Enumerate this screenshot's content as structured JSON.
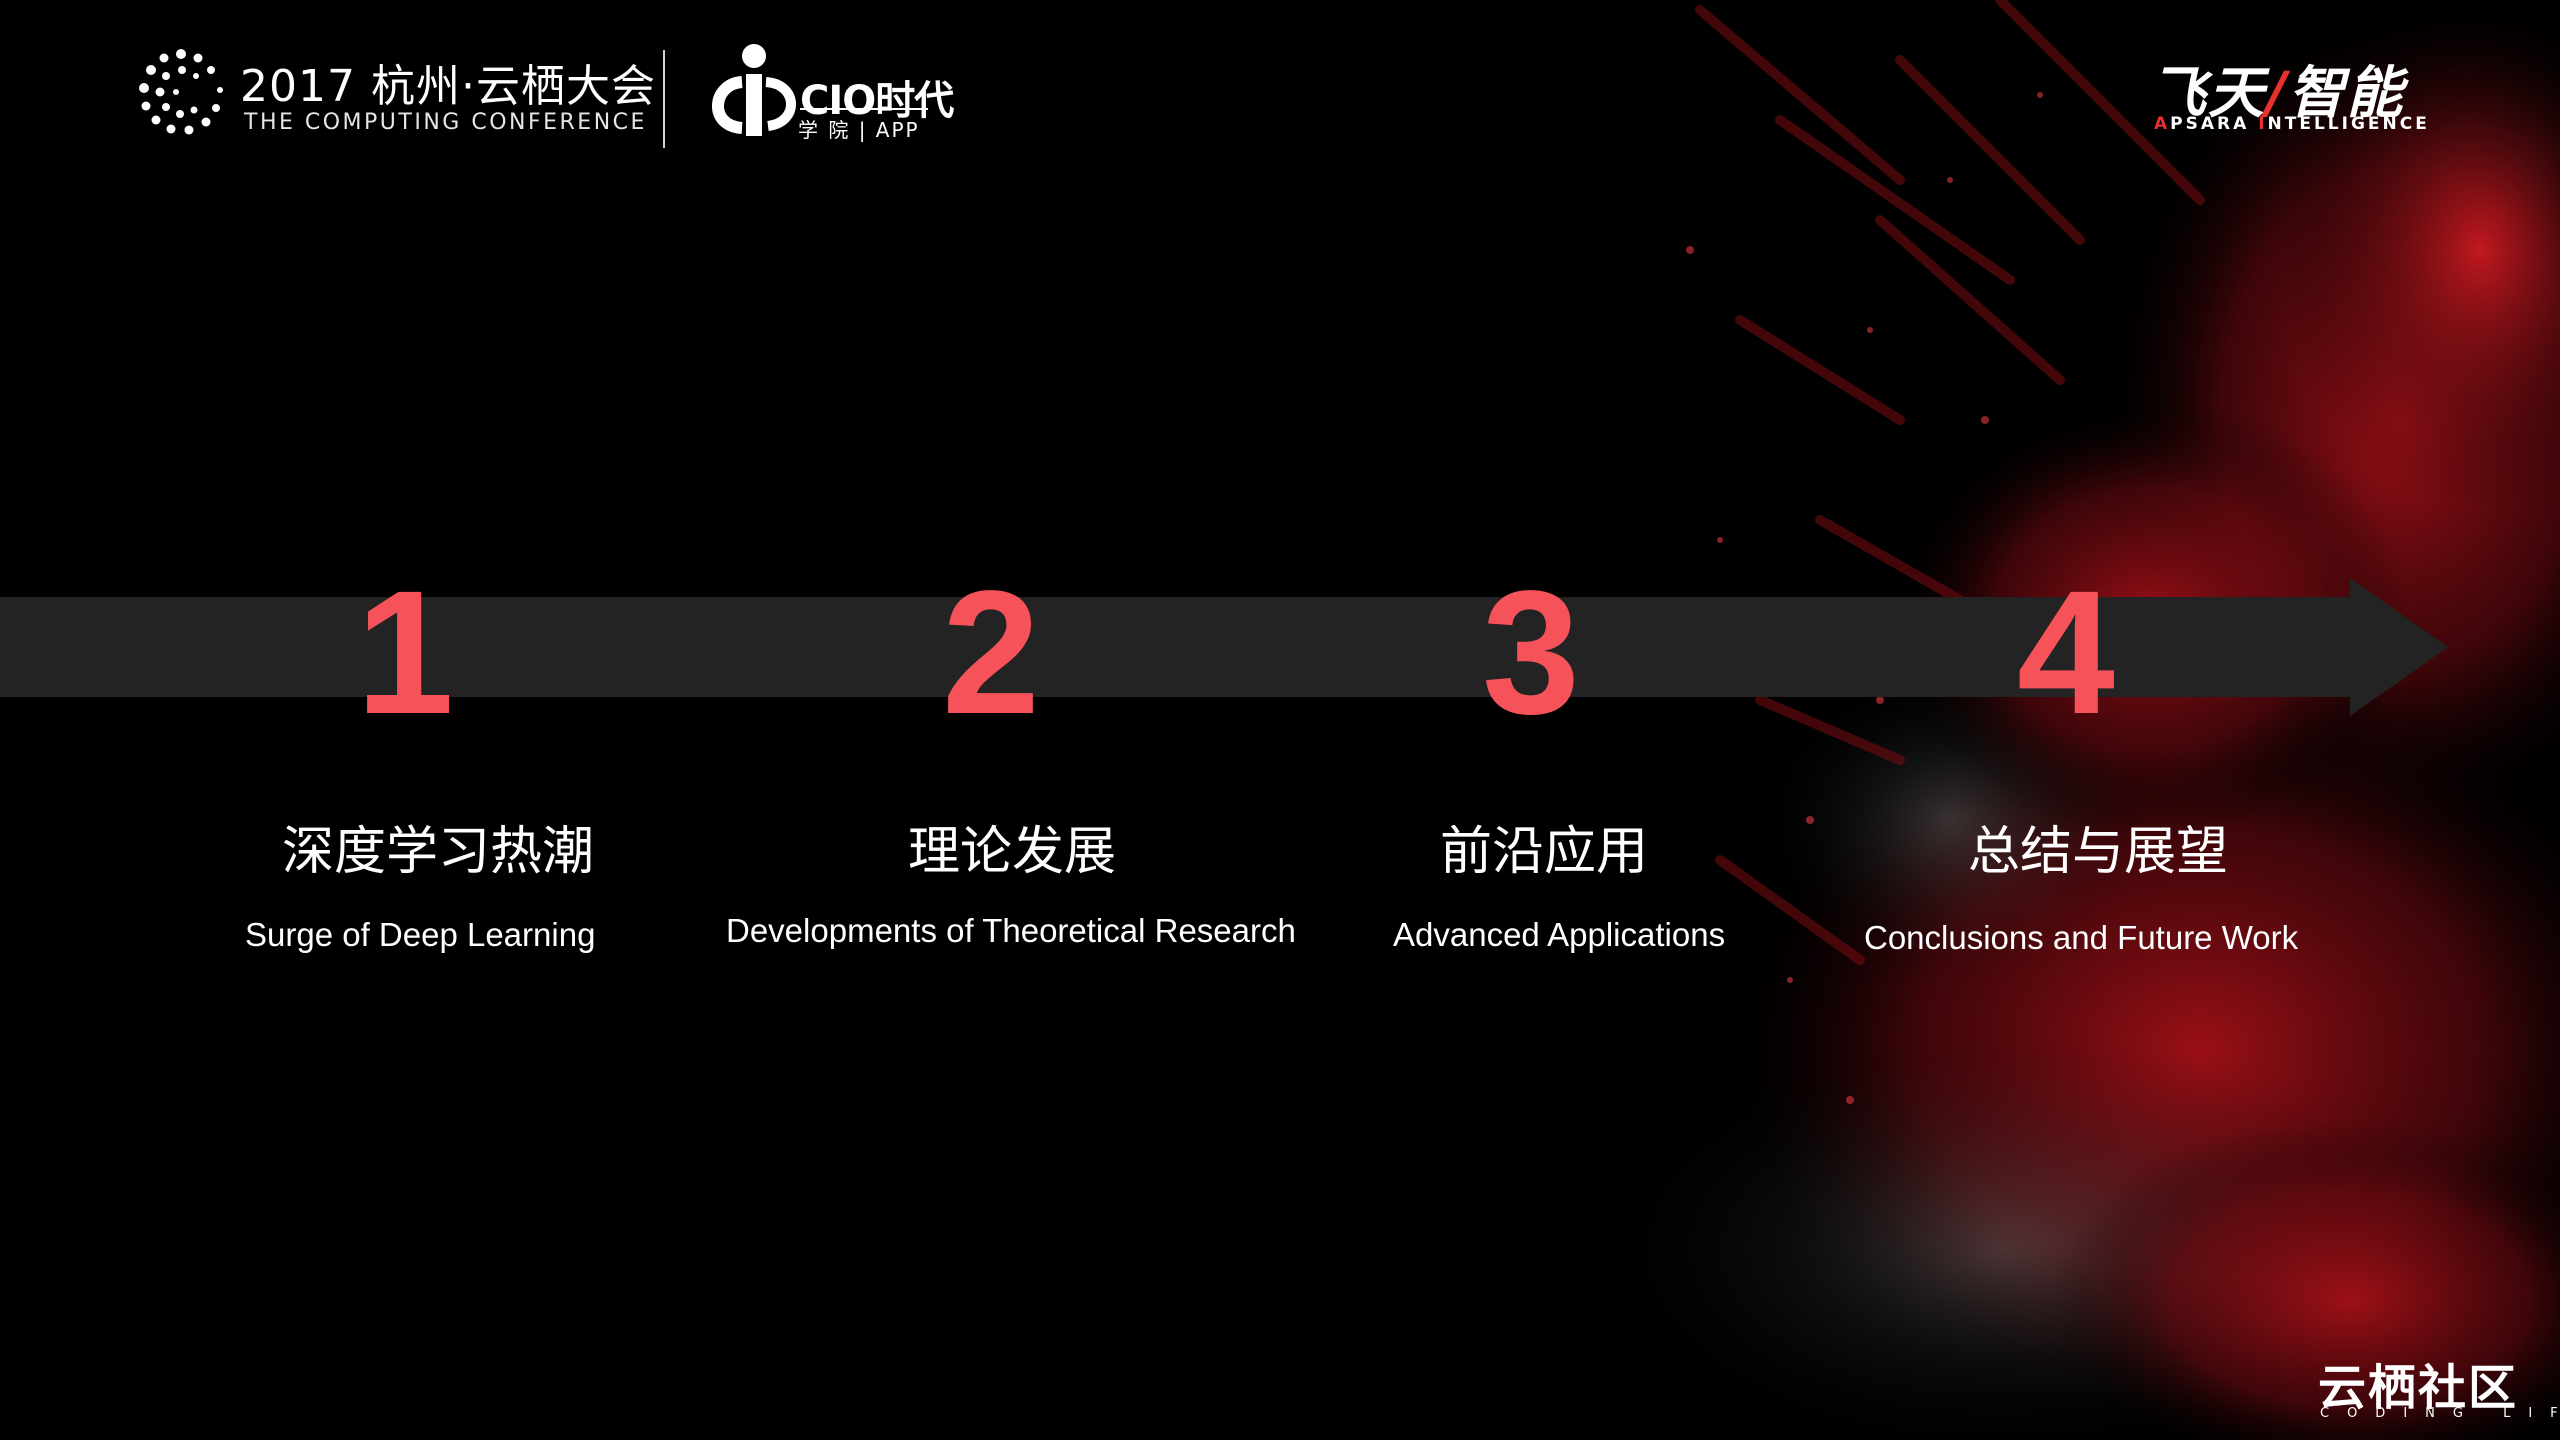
{
  "header": {
    "conference_title": "2017 杭州·云栖大会",
    "conference_subtitle": "THE COMPUTING CONFERENCE",
    "cio_title": "CIO时代",
    "cio_subtitle": "学 院  |  APP",
    "apsara_title_left": "飞天",
    "apsara_slash": "/",
    "apsara_title_right": "智能",
    "apsara_sub_a": "A",
    "apsara_sub_b": "PSARA ",
    "apsara_sub_c": "I",
    "apsara_sub_d": "NTELLIGENCE"
  },
  "steps": [
    {
      "number": "1",
      "title_cn": "深度学习热潮",
      "title_en": "Surge of Deep Learning"
    },
    {
      "number": "2",
      "title_cn": "理论发展",
      "title_en": "Developments of Theoretical Research"
    },
    {
      "number": "3",
      "title_cn": "前沿应用",
      "title_en": "Advanced Applications"
    },
    {
      "number": "4",
      "title_cn": "总结与展望",
      "title_en": "Conclusions and Future Work"
    }
  ],
  "footer": {
    "logo_text": "云栖社区",
    "logo_sub": "CODING LIFE"
  },
  "colors": {
    "background": "#000000",
    "number_accent": "#f5525a",
    "timeline": "#232323",
    "brand_red": "#e8302f",
    "particle_red": "#c0141c"
  }
}
